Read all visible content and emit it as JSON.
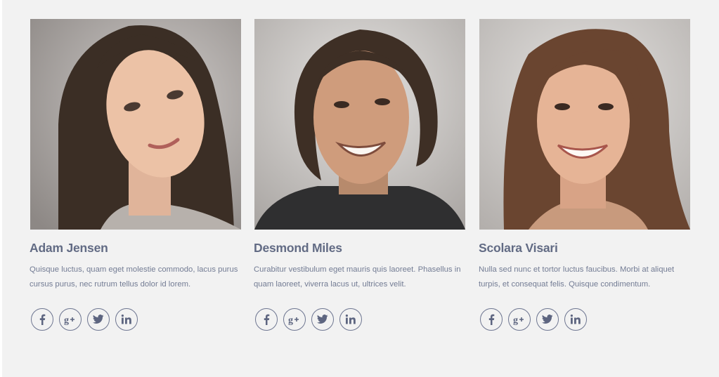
{
  "team": [
    {
      "name": "Adam Jensen",
      "description": "Quisque luctus, quam eget molestie commodo, lacus purus cursus purus, nec rutrum tellus dolor id lorem.",
      "photo": "woman-curly-brown-hair-portrait",
      "social": [
        {
          "icon": "facebook-icon",
          "glyph": "f"
        },
        {
          "icon": "google-plus-icon",
          "glyph": "g+"
        },
        {
          "icon": "twitter-icon",
          "glyph": "t"
        },
        {
          "icon": "linkedin-icon",
          "glyph": "in"
        }
      ]
    },
    {
      "name": "Desmond Miles",
      "description": "Curabitur vestibulum eget mauris quis laoreet. Phasellus in quam laoreet, viverra lacus ut, ultrices velit.",
      "photo": "smiling-man-long-hair-portrait",
      "social": [
        {
          "icon": "facebook-icon",
          "glyph": "f"
        },
        {
          "icon": "google-plus-icon",
          "glyph": "g+"
        },
        {
          "icon": "twitter-icon",
          "glyph": "t"
        },
        {
          "icon": "linkedin-icon",
          "glyph": "in"
        }
      ]
    },
    {
      "name": "Scolara Visari",
      "description": "Nulla sed nunc et tortor luctus faucibus. Morbi at aliquet turpis, et consequat felis. Quisque condimentum.",
      "photo": "smiling-woman-long-hair-portrait",
      "social": [
        {
          "icon": "facebook-icon",
          "glyph": "f"
        },
        {
          "icon": "google-plus-icon",
          "glyph": "g+"
        },
        {
          "icon": "twitter-icon",
          "glyph": "t"
        },
        {
          "icon": "linkedin-icon",
          "glyph": "in"
        }
      ]
    }
  ],
  "colors": {
    "background": "#f2f2f2",
    "name_text": "#626b84",
    "body_text": "#737c94",
    "icon_stroke": "#6d7590"
  }
}
